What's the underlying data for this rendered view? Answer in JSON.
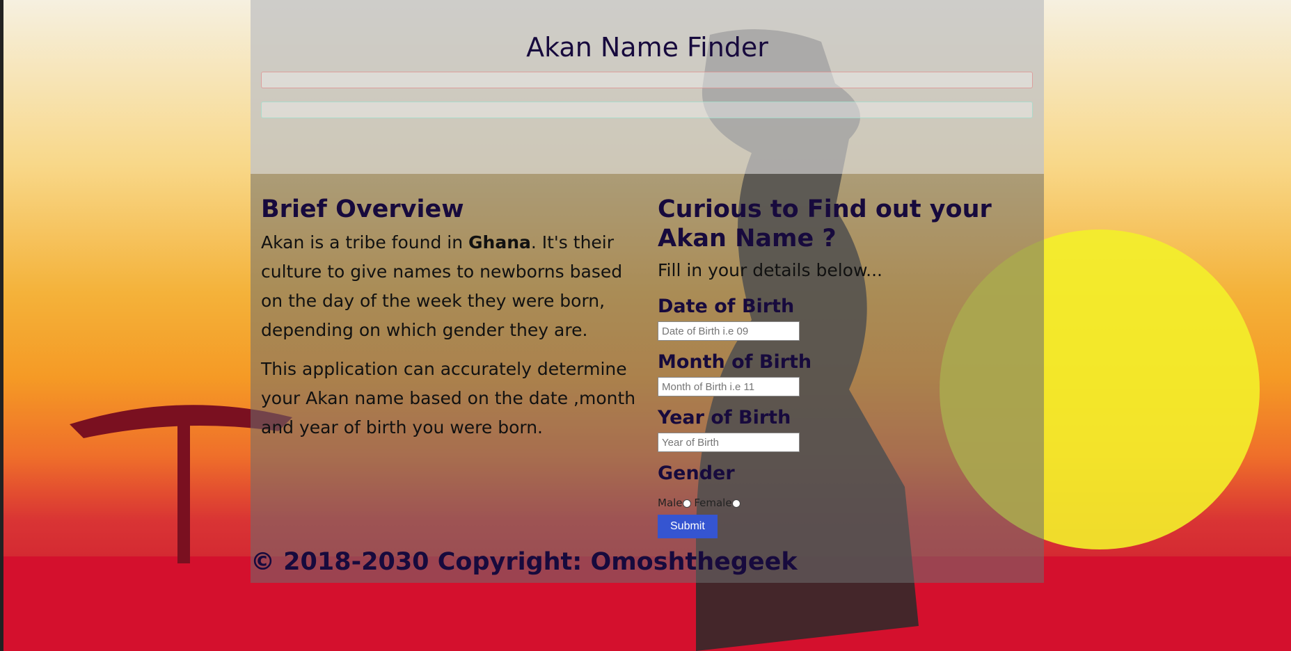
{
  "header": {
    "title": "Akan Name Finder"
  },
  "overview": {
    "heading": "Brief Overview",
    "para1_pre": "Akan is a tribe found in ",
    "para1_bold": "Ghana",
    "para1_post": ". It's their culture to give names to newborns based on the day of the week they were born, depending on which gender they are.",
    "para2": "This application can accurately determine your Akan name based on the date ,month and year of birth you were born."
  },
  "form": {
    "heading": "Curious to Find out your Akan Name ?",
    "intro": "Fill in your details below...",
    "dob_label": "Date of Birth",
    "dob_placeholder": "Date of Birth i.e 09",
    "mob_label": "Month of Birth",
    "mob_placeholder": "Month of Birth i.e 11",
    "yob_label": "Year of Birth",
    "yob_placeholder": "Year of Birth",
    "gender_label": "Gender",
    "male_label": "Male",
    "female_label": "Female",
    "submit_label": "Submit"
  },
  "footer": {
    "text": "© 2018-2030 Copyright: Omoshthegeek"
  }
}
